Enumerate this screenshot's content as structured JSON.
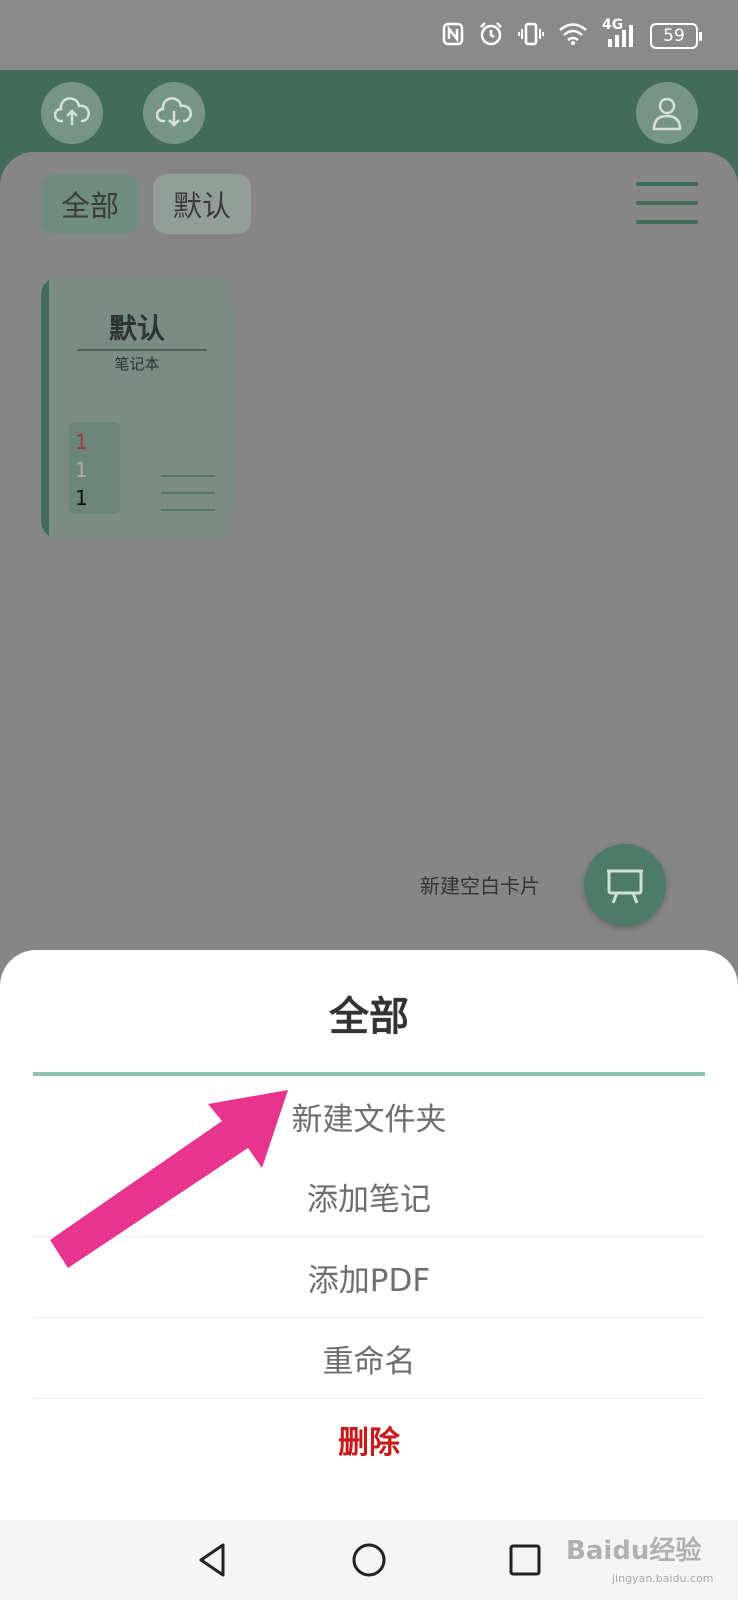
{
  "status_bar": {
    "network": "4G",
    "battery": "59",
    "icons": [
      "nfc-icon",
      "alarm-icon",
      "vibrate-icon",
      "wifi-icon",
      "signal-icon",
      "battery-icon"
    ]
  },
  "header": {
    "icons": [
      "cloud-upload-icon",
      "cloud-download-icon",
      "user-icon"
    ]
  },
  "tabs": [
    {
      "label": "全部",
      "selected": true
    },
    {
      "label": "默认",
      "selected": false
    }
  ],
  "notebook_card": {
    "title": "默认",
    "subtitle": "笔记本",
    "numbers": [
      "1",
      "1",
      "1"
    ]
  },
  "fab": {
    "label": "新建空白卡片",
    "icon": "easel-icon"
  },
  "sheet": {
    "title": "全部",
    "options": [
      {
        "label": "新建文件夹"
      },
      {
        "label": "添加笔记"
      },
      {
        "label": "添加PDF"
      },
      {
        "label": "重命名"
      },
      {
        "label": "删除",
        "danger": true
      }
    ]
  },
  "watermark": {
    "brand": "Baidu经验",
    "url": "jingyan.baidu.com"
  },
  "colors": {
    "accent": "#436b5a",
    "sheet_divider": "#8bc4b0",
    "danger": "#c81a1a",
    "arrow": "#e6348f"
  }
}
